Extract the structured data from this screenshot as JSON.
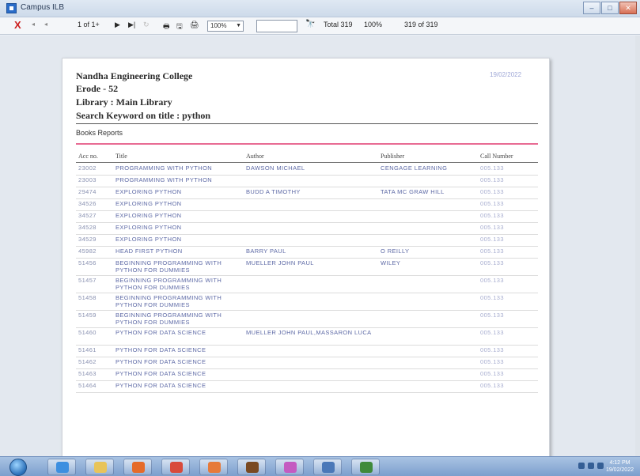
{
  "window": {
    "title": "Campus ILB",
    "minimize": "–",
    "maximize": "□",
    "close": "✕"
  },
  "toolbar": {
    "close_glyph": "X",
    "first_glyph": "◂",
    "prev_glyph": "◂",
    "page_info": "1 of 1+",
    "next_glyph": "▶",
    "last_glyph": "▶|",
    "refresh_glyph": "↻",
    "print_glyph": "🖶",
    "export_glyph": "🖫",
    "layout_glyph": "🖨",
    "zoom_value": "100%",
    "find_value": "",
    "find_glyph": "🔭",
    "total_text": "Total 319",
    "percent_text": "100%",
    "count_text": "319 of 319"
  },
  "report": {
    "college": "Nandha Engineering College",
    "city": "Erode - 52",
    "library": "Library : Main Library",
    "search": "Search Keyword on title : python",
    "date": "19/02/2022",
    "section": "Books Reports",
    "columns": {
      "acc": "Acc no.",
      "title": "Title",
      "author": "Author",
      "publisher": "Publisher",
      "call": "Call Number"
    },
    "rows": [
      {
        "acc": "23002",
        "title": "PROGRAMMING WITH PYTHON",
        "author": "DAWSON MICHAEL",
        "publisher": "CENGAGE LEARNING",
        "call": "005.133"
      },
      {
        "acc": "23003",
        "title": "PROGRAMMING WITH PYTHON",
        "author": "",
        "publisher": "",
        "call": "005.133"
      },
      {
        "acc": "29474",
        "title": "EXPLORING PYTHON",
        "author": "BUDD A TIMOTHY",
        "publisher": "TATA MC GRAW HILL",
        "call": "005.133"
      },
      {
        "acc": "34526",
        "title": "EXPLORING PYTHON",
        "author": "",
        "publisher": "",
        "call": "005.133"
      },
      {
        "acc": "34527",
        "title": "EXPLORING PYTHON",
        "author": "",
        "publisher": "",
        "call": "005.133"
      },
      {
        "acc": "34528",
        "title": "EXPLORING PYTHON",
        "author": "",
        "publisher": "",
        "call": "005.133"
      },
      {
        "acc": "34529",
        "title": "EXPLORING PYTHON",
        "author": "",
        "publisher": "",
        "call": "005.133"
      },
      {
        "acc": "45982",
        "title": "HEAD FIRST PYTHON",
        "author": "BARRY PAUL",
        "publisher": "O REILLY",
        "call": "005.133"
      },
      {
        "acc": "51456",
        "title": "BEGINNING PROGRAMMING WITH PYTHON FOR DUMMIES",
        "author": "MUELLER JOHN PAUL",
        "publisher": "WILEY",
        "call": "005.133"
      },
      {
        "acc": "51457",
        "title": "BEGINNING PROGRAMMING WITH PYTHON FOR DUMMIES",
        "author": "",
        "publisher": "",
        "call": "005.133"
      },
      {
        "acc": "51458",
        "title": "BEGINNING PROGRAMMING WITH PYTHON FOR DUMMIES",
        "author": "",
        "publisher": "",
        "call": "005.133"
      },
      {
        "acc": "51459",
        "title": "BEGINNING PROGRAMMING WITH PYTHON FOR DUMMIES",
        "author": "",
        "publisher": "",
        "call": "005.133"
      },
      {
        "acc": "51460",
        "title": "PYTHON FOR DATA SCIENCE",
        "author": "MUELLER JOHN PAUL,MASSARON LUCA",
        "publisher": "",
        "call": "005.133"
      },
      {
        "acc": "51461",
        "title": "PYTHON FOR DATA SCIENCE",
        "author": "",
        "publisher": "",
        "call": "005.133"
      },
      {
        "acc": "51462",
        "title": "PYTHON FOR DATA SCIENCE",
        "author": "",
        "publisher": "",
        "call": "005.133"
      },
      {
        "acc": "51463",
        "title": "PYTHON FOR DATA SCIENCE",
        "author": "",
        "publisher": "",
        "call": "005.133"
      },
      {
        "acc": "51464",
        "title": "PYTHON FOR DATA SCIENCE",
        "author": "",
        "publisher": "",
        "call": "005.133"
      }
    ]
  },
  "taskbar": {
    "clock_time": "4:12 PM",
    "clock_date": "19/02/2022"
  },
  "colors": {
    "accent_pink": "#e86b93",
    "row_text": "#5e6aa6",
    "date_text": "#9ea7d6"
  }
}
